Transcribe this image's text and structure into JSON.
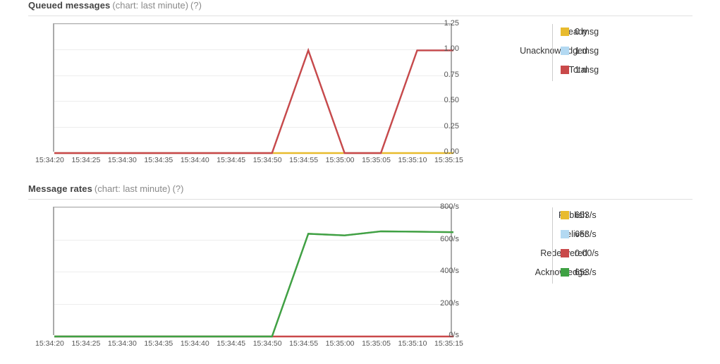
{
  "colors": {
    "ready": "#e8bb2e",
    "unacknowledged": "#b3d9f2",
    "total": "#c9494a",
    "publish": "#e8bb2e",
    "deliver": "#b3d9f2",
    "redelivered": "#c9494a",
    "acknowledge": "#3fa144",
    "axis": "#aaaaaa",
    "grid": "#ededed",
    "divider": "#e0e0e0"
  },
  "sections": [
    {
      "id": "queued",
      "title": "Queued messages",
      "subtitle": "(chart: last minute)",
      "help": "(?)",
      "legend": [
        {
          "label": "Ready",
          "value": "0 msg",
          "color": "#e8bb2e"
        },
        {
          "label": "Unacknowledged",
          "value": "1 msg",
          "color": "#b3d9f2"
        },
        {
          "label": "Total",
          "value": "1 msg",
          "color": "#c9494a"
        }
      ]
    },
    {
      "id": "rates",
      "title": "Message rates",
      "subtitle": "(chart: last minute)",
      "help": "(?)",
      "legend": [
        {
          "label": "Publish",
          "value": "653/s",
          "color": "#e8bb2e"
        },
        {
          "label": "Deliver",
          "value": "653/s",
          "color": "#b3d9f2"
        },
        {
          "label": "Redelivered",
          "value": "0.00/s",
          "color": "#c9494a"
        },
        {
          "label": "Acknowledge",
          "value": "653/s",
          "color": "#3fa144"
        }
      ]
    }
  ],
  "chart_data": [
    {
      "type": "line",
      "id": "queued-messages-chart",
      "title": "Queued messages (chart: last minute)",
      "xlabel": "",
      "ylabel": "",
      "grid": true,
      "legend_position": "right",
      "x": [
        "15:34:20",
        "15:34:25",
        "15:34:30",
        "15:34:35",
        "15:34:40",
        "15:34:45",
        "15:34:50",
        "15:34:55",
        "15:35:00",
        "15:35:05",
        "15:35:10",
        "15:35:15"
      ],
      "yticks": [
        "0.00",
        "0.25",
        "0.50",
        "0.75",
        "1.00",
        "1.25"
      ],
      "ylim": [
        0,
        1.25
      ],
      "series": [
        {
          "name": "Ready",
          "color": "#e8bb2e",
          "values": [
            0,
            0,
            0,
            0,
            0,
            0,
            0,
            0,
            0,
            0,
            0,
            0
          ]
        },
        {
          "name": "Unacknowledged",
          "color": "#b3d9f2",
          "values": [
            0,
            0,
            0,
            0,
            0,
            0,
            0,
            1,
            0,
            0,
            1,
            1
          ]
        },
        {
          "name": "Total",
          "color": "#c9494a",
          "values": [
            0,
            0,
            0,
            0,
            0,
            0,
            0,
            1,
            0,
            0,
            1,
            1
          ]
        }
      ]
    },
    {
      "type": "line",
      "id": "message-rates-chart",
      "title": "Message rates (chart: last minute)",
      "xlabel": "",
      "ylabel": "",
      "grid": true,
      "legend_position": "right",
      "x": [
        "15:34:20",
        "15:34:25",
        "15:34:30",
        "15:34:35",
        "15:34:40",
        "15:34:45",
        "15:34:50",
        "15:34:55",
        "15:35:00",
        "15:35:05",
        "15:35:10",
        "15:35:15"
      ],
      "yticks": [
        "0/s",
        "200/s",
        "400/s",
        "600/s",
        "800/s"
      ],
      "ylim": [
        0,
        800
      ],
      "series": [
        {
          "name": "Publish",
          "color": "#e8bb2e",
          "values": [
            0,
            0,
            0,
            0,
            0,
            0,
            0,
            640,
            630,
            655,
            653,
            650
          ]
        },
        {
          "name": "Deliver",
          "color": "#b3d9f2",
          "values": [
            0,
            0,
            0,
            0,
            0,
            0,
            0,
            640,
            630,
            655,
            653,
            650
          ]
        },
        {
          "name": "Redelivered",
          "color": "#c9494a",
          "values": [
            0,
            0,
            0,
            0,
            0,
            0,
            0,
            0,
            0,
            0,
            0,
            0
          ]
        },
        {
          "name": "Acknowledge",
          "color": "#3fa144",
          "values": [
            0,
            0,
            0,
            0,
            0,
            0,
            0,
            640,
            630,
            655,
            653,
            650
          ]
        }
      ]
    }
  ]
}
